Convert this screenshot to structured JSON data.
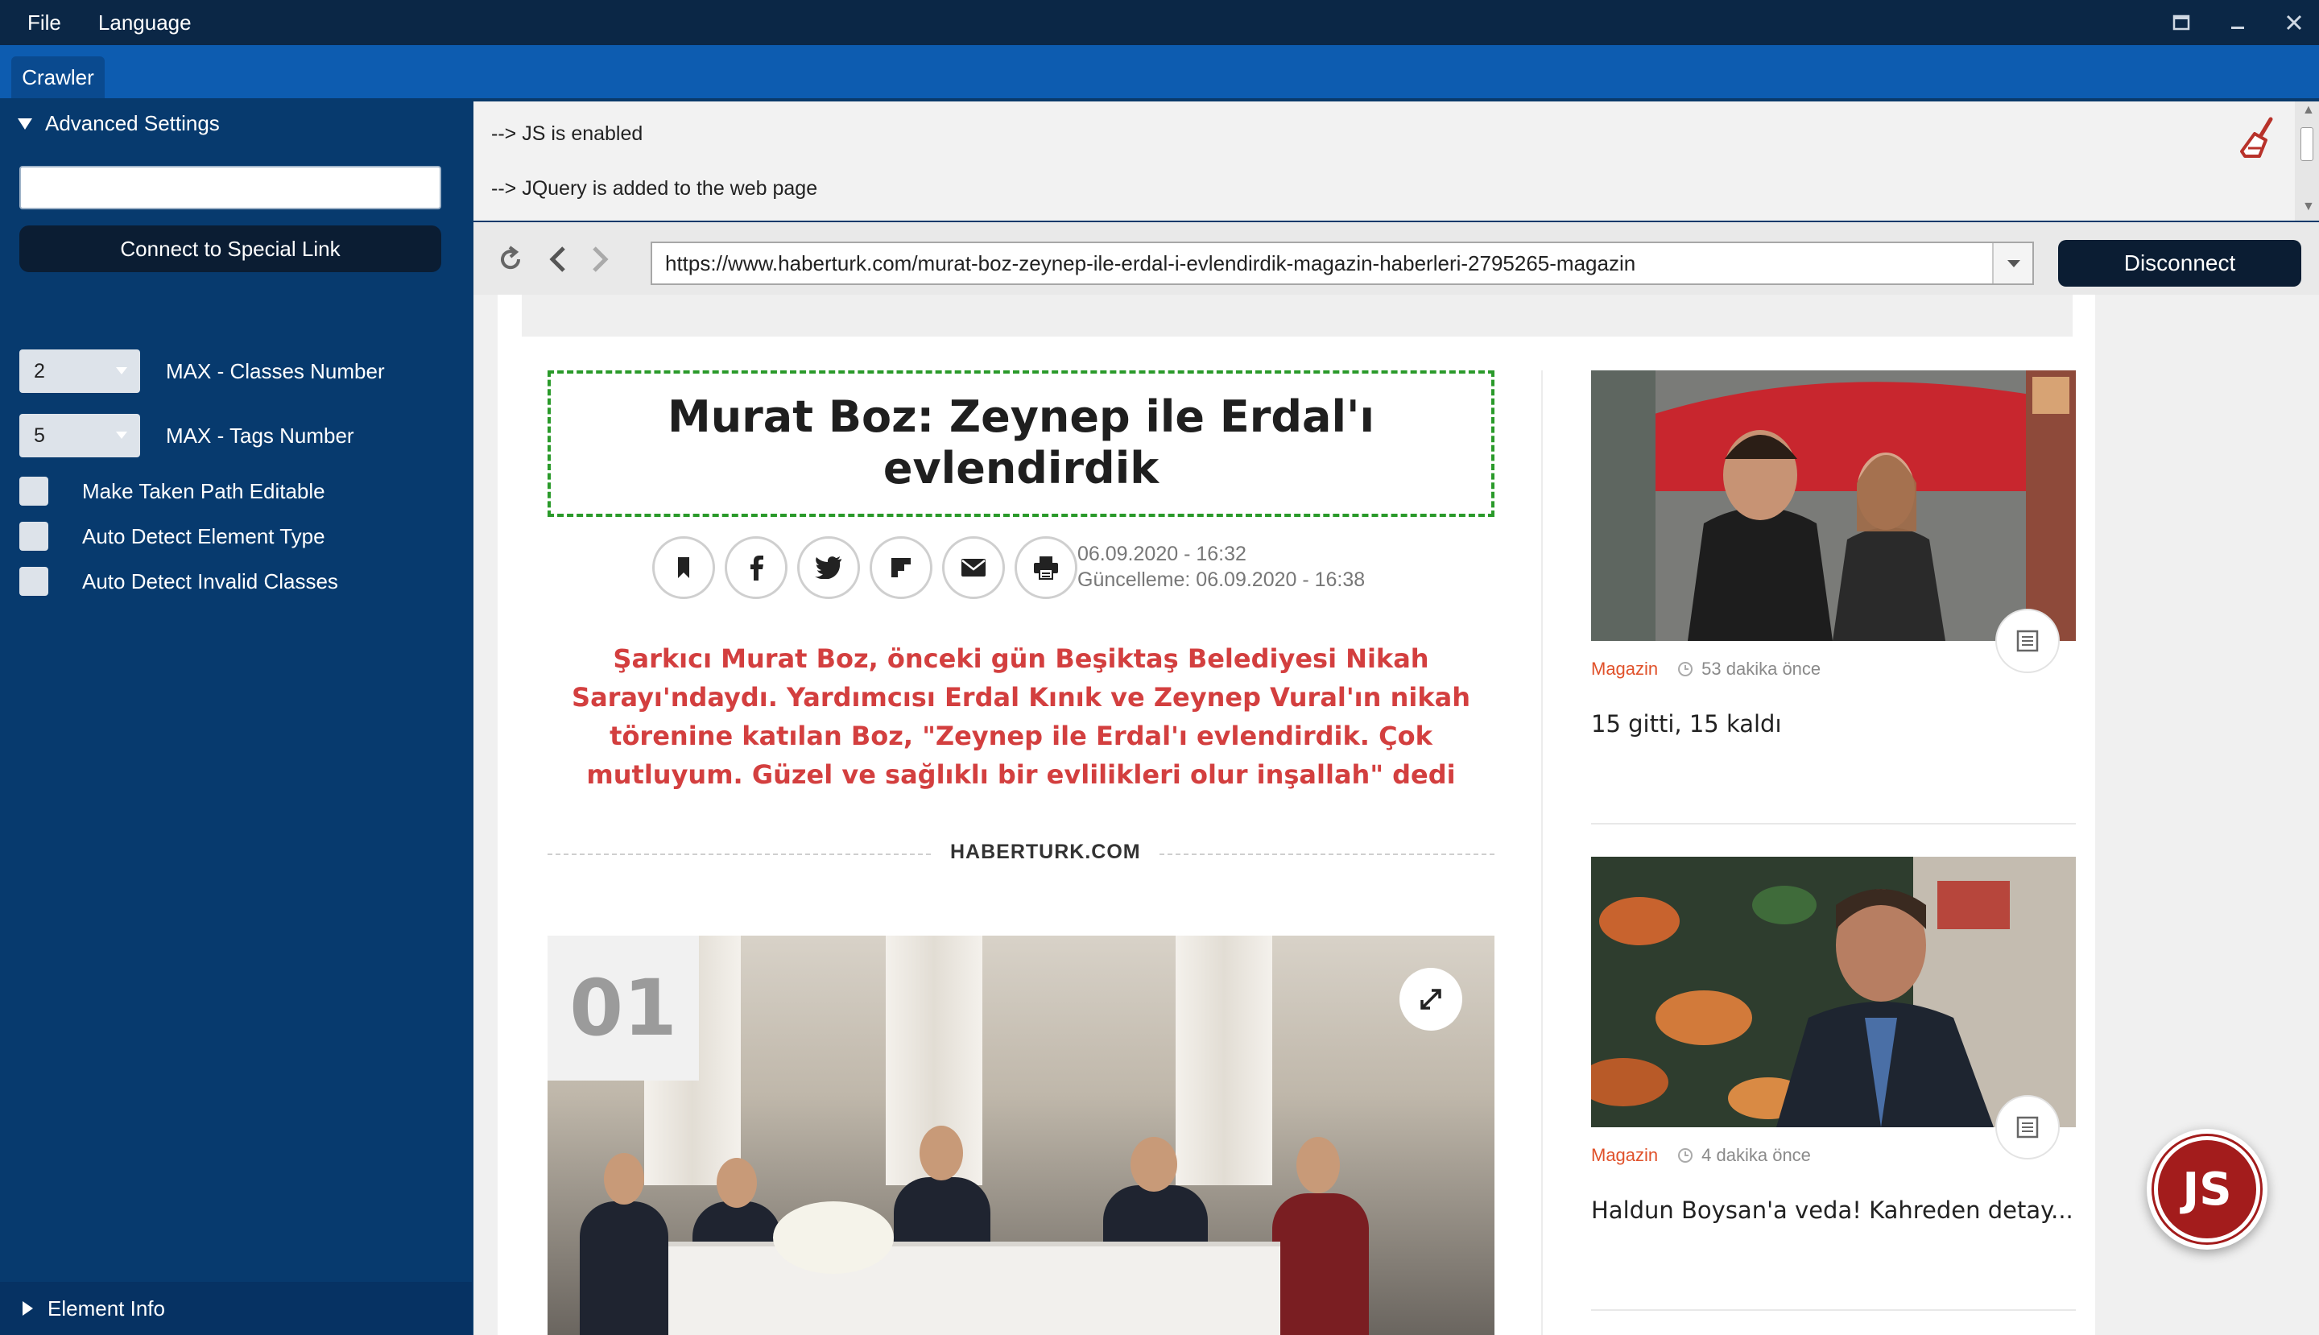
{
  "menubar": {
    "file": "File",
    "language": "Language"
  },
  "tabs": [
    {
      "label": "Crawler"
    }
  ],
  "sidebar": {
    "advanced_settings": "Advanced Settings",
    "special_link_value": "",
    "connect_special_link": "Connect to Special Link",
    "max_classes_value": "2",
    "max_classes_label": "MAX - Classes Number",
    "max_tags_value": "5",
    "max_tags_label": "MAX - Tags Number",
    "checkboxes": [
      {
        "label": "Make Taken Path Editable",
        "checked": false
      },
      {
        "label": "Auto Detect Element Type",
        "checked": false
      },
      {
        "label": "Auto Detect Invalid Classes",
        "checked": false
      }
    ],
    "element_info": "Element Info"
  },
  "log": {
    "lines": [
      "-->  JS is enabled",
      "-->  JQuery is added to the web page"
    ]
  },
  "nav": {
    "url": "https://www.haberturk.com/murat-boz-zeynep-ile-erdal-i-evlendirdik-magazin-haberleri-2795265-magazin",
    "disconnect": "Disconnect"
  },
  "article": {
    "title": "Murat Boz: Zeynep ile Erdal'ı evlendirdik",
    "published": "06.09.2020 - 16:32",
    "updated": "Güncelleme: 06.09.2020 - 16:38",
    "spot": "Şarkıcı Murat Boz, önceki gün Beşiktaş Belediyesi Nikah Sarayı'ndaydı. Yardımcısı Erdal Kınık ve Zeynep Vural'ın nikah törenine katılan Boz, \"Zeynep ile Erdal'ı evlendirdik. Çok mutluyum. Güzel ve sağlıklı bir evlilikleri olur inşallah\" dedi",
    "source": "HABERTURK.COM",
    "gallery_number": "01"
  },
  "cards": [
    {
      "category": "Magazin",
      "time": "53 dakika önce",
      "title": "15 gitti, 15 kaldı"
    },
    {
      "category": "Magazin",
      "time": "4 dakika önce",
      "title": "Haldun Boysan'a veda! Kahreden detay..."
    }
  ],
  "js_badge": "JS",
  "colors": {
    "accent": "#0d5cb0",
    "sidebar": "#073a6e",
    "spot_red": "#d33f3f",
    "category_orange": "#e0512a",
    "js_red": "#a31c1c"
  }
}
